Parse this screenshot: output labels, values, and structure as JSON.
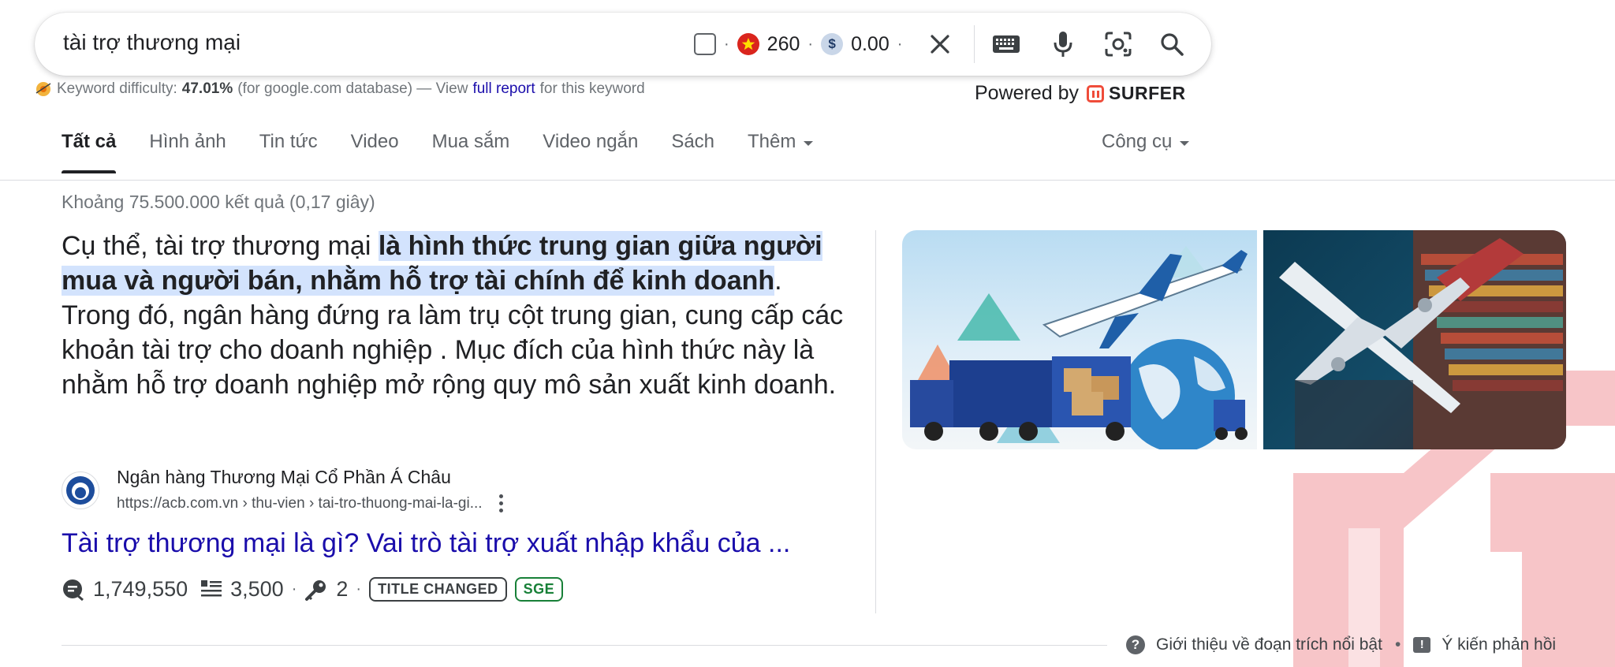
{
  "search": {
    "query": "tài trợ thương mại",
    "volume": "260",
    "cpc": "0.00",
    "dollar_symbol": "$",
    "separator": "·"
  },
  "surfer": {
    "kd_label": "Keyword difficulty:",
    "kd_value": "47.01%",
    "kd_db": "(for google.com database) — View",
    "kd_link": "full report",
    "kd_suffix": "for this keyword",
    "powered_by": "Powered by",
    "brand": "SURFER",
    "brand_color": "#ef4c3a"
  },
  "tabs": [
    {
      "label": "Tất cả"
    },
    {
      "label": "Hình ảnh"
    },
    {
      "label": "Tin tức"
    },
    {
      "label": "Video"
    },
    {
      "label": "Mua sắm"
    },
    {
      "label": "Video ngắn"
    },
    {
      "label": "Sách"
    },
    {
      "label": "Thêm"
    }
  ],
  "tools_label": "Công cụ",
  "result_stats": "Khoảng 75.500.000 kết quả (0,17 giây)",
  "snippet": {
    "before": "Cụ thể, tài trợ thương mại ",
    "highlight": "là hình thức trung gian giữa người mua và người bán, nhằm hỗ trợ tài chính để kinh doanh",
    "after": ". Trong đó, ngân hàng đứng ra làm trụ cột trung gian, cung cấp các khoản tài trợ cho doanh nghiệp . Mục đích của hình thức này là nhằm hỗ trợ doanh nghiệp mở rộng quy mô sản xuất kinh doanh."
  },
  "source": {
    "name": "Ngân hàng Thương Mại Cổ Phần Á Châu",
    "url": "https://acb.com.vn › thu-vien › tai-tro-thuong-mai-la-gi...",
    "title": "Tài trợ thương mại là gì? Vai trò tài trợ xuất nhập khẩu của ..."
  },
  "metrics": {
    "traffic": "1,749,550",
    "words": "3,500",
    "keywords": "2",
    "badge_title_changed": "TITLE CHANGED",
    "badge_sge": "SGE",
    "separator": "·"
  },
  "footer": {
    "about": "Giới thiệu về đoạn trích nổi bật",
    "feedback": "Ý kiến phản hồi",
    "bullet": "•",
    "help_glyph": "?",
    "feedback_glyph": "!"
  },
  "colors": {
    "link": "#1a0dab",
    "highlight_bg": "#d3e3fd",
    "sge_green": "#188038",
    "watermark": "#f7c5c8"
  }
}
